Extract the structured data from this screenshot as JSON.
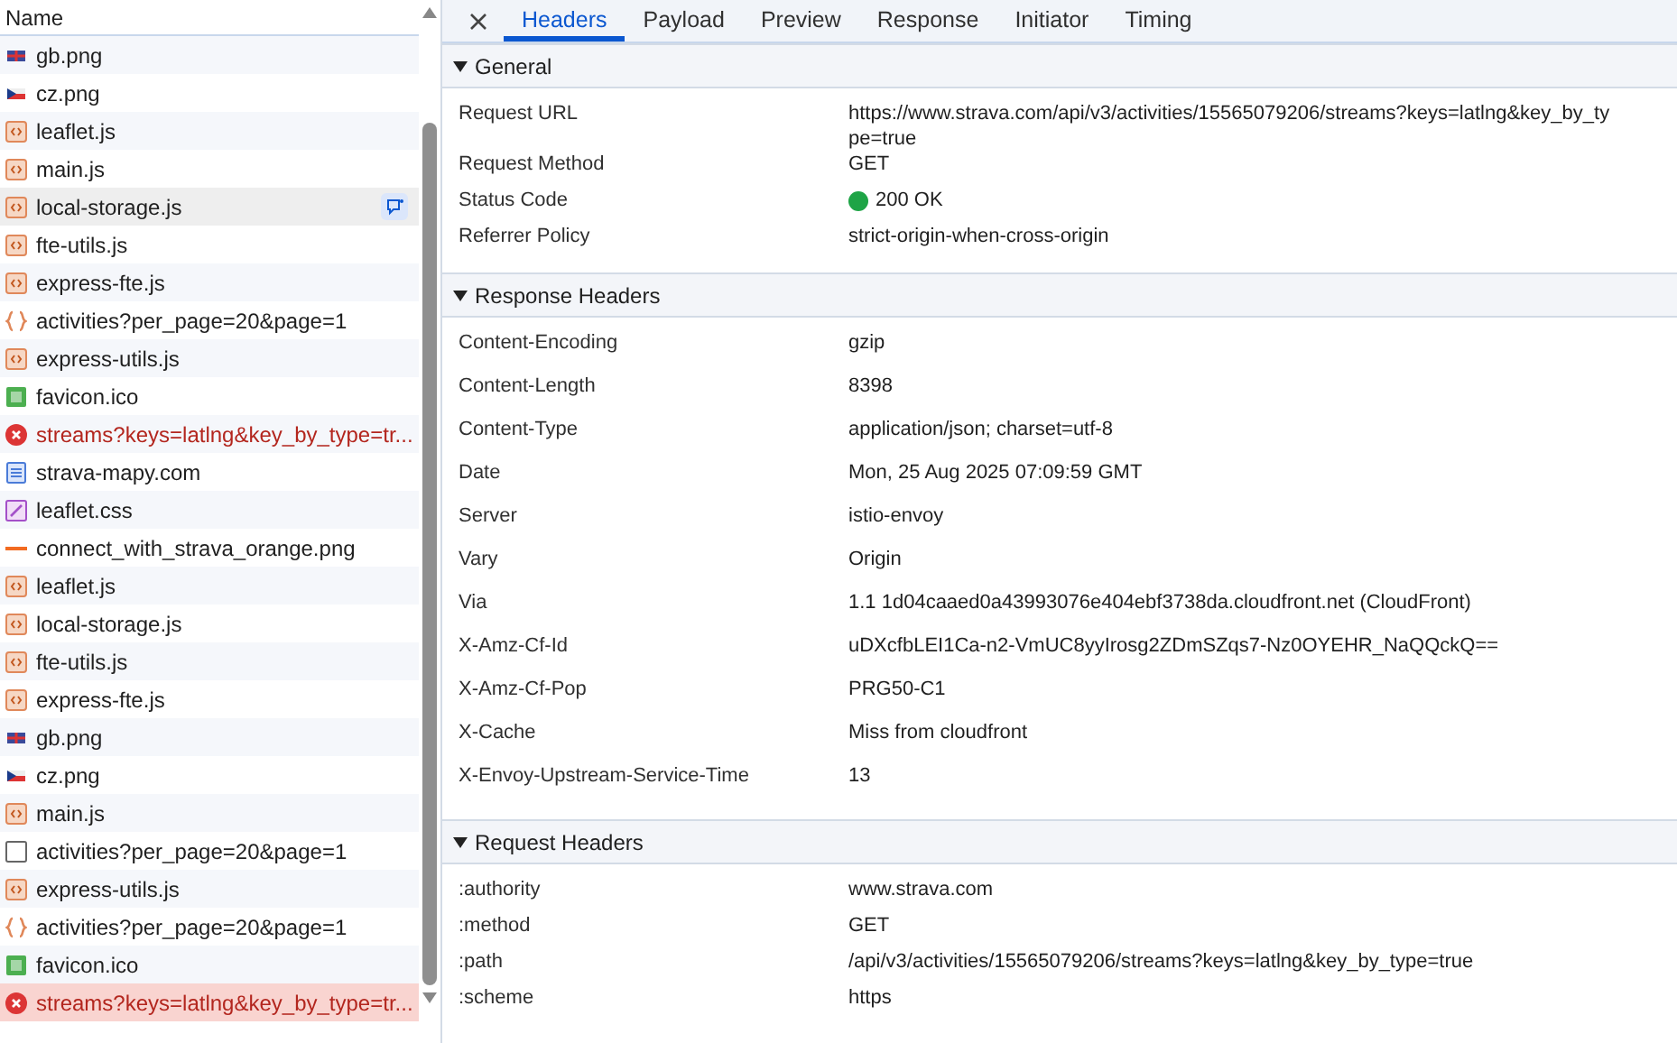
{
  "request_list": {
    "header": "Name",
    "rows": [
      {
        "name": "gb.png",
        "kind": "flag-gb",
        "error": false,
        "selected": false,
        "hovered": false
      },
      {
        "name": "cz.png",
        "kind": "flag-cz",
        "error": false,
        "selected": false,
        "hovered": false
      },
      {
        "name": "leaflet.js",
        "kind": "script",
        "error": false,
        "selected": false,
        "hovered": false
      },
      {
        "name": "main.js",
        "kind": "script",
        "error": false,
        "selected": false,
        "hovered": false
      },
      {
        "name": "local-storage.js",
        "kind": "script",
        "error": false,
        "selected": false,
        "hovered": true
      },
      {
        "name": "fte-utils.js",
        "kind": "script",
        "error": false,
        "selected": false,
        "hovered": false
      },
      {
        "name": "express-fte.js",
        "kind": "script",
        "error": false,
        "selected": false,
        "hovered": false
      },
      {
        "name": "activities?per_page=20&page=1",
        "kind": "fetch",
        "error": false,
        "selected": false,
        "hovered": false
      },
      {
        "name": "express-utils.js",
        "kind": "script",
        "error": false,
        "selected": false,
        "hovered": false
      },
      {
        "name": "favicon.ico",
        "kind": "image",
        "error": false,
        "selected": false,
        "hovered": false
      },
      {
        "name": "streams?keys=latlng&key_by_type=tr...",
        "kind": "error",
        "error": true,
        "selected": false,
        "hovered": false
      },
      {
        "name": "strava-mapy.com",
        "kind": "document",
        "error": false,
        "selected": false,
        "hovered": false
      },
      {
        "name": "leaflet.css",
        "kind": "stylesheet",
        "error": false,
        "selected": false,
        "hovered": false
      },
      {
        "name": "connect_with_strava_orange.png",
        "kind": "banner",
        "error": false,
        "selected": false,
        "hovered": false
      },
      {
        "name": "leaflet.js",
        "kind": "script",
        "error": false,
        "selected": false,
        "hovered": false
      },
      {
        "name": "local-storage.js",
        "kind": "script",
        "error": false,
        "selected": false,
        "hovered": false
      },
      {
        "name": "fte-utils.js",
        "kind": "script",
        "error": false,
        "selected": false,
        "hovered": false
      },
      {
        "name": "express-fte.js",
        "kind": "script",
        "error": false,
        "selected": false,
        "hovered": false
      },
      {
        "name": "gb.png",
        "kind": "flag-gb",
        "error": false,
        "selected": false,
        "hovered": false
      },
      {
        "name": "cz.png",
        "kind": "flag-cz",
        "error": false,
        "selected": false,
        "hovered": false
      },
      {
        "name": "main.js",
        "kind": "script",
        "error": false,
        "selected": false,
        "hovered": false
      },
      {
        "name": "activities?per_page=20&page=1",
        "kind": "other",
        "error": false,
        "selected": false,
        "hovered": false
      },
      {
        "name": "express-utils.js",
        "kind": "script",
        "error": false,
        "selected": false,
        "hovered": false
      },
      {
        "name": "activities?per_page=20&page=1",
        "kind": "fetch",
        "error": false,
        "selected": false,
        "hovered": false
      },
      {
        "name": "favicon.ico",
        "kind": "image",
        "error": false,
        "selected": false,
        "hovered": false
      },
      {
        "name": "streams?keys=latlng&key_by_type=tr...",
        "kind": "error",
        "error": true,
        "selected": true,
        "hovered": false
      }
    ]
  },
  "tabs": [
    {
      "label": "Headers",
      "selected": true
    },
    {
      "label": "Payload",
      "selected": false
    },
    {
      "label": "Preview",
      "selected": false
    },
    {
      "label": "Response",
      "selected": false
    },
    {
      "label": "Initiator",
      "selected": false
    },
    {
      "label": "Timing",
      "selected": false
    }
  ],
  "sections": [
    {
      "title": "General",
      "expanded": true,
      "rows": [
        {
          "name": "Request URL",
          "value": "https://www.strava.com/api/v3/activities/15565079206/streams?keys=latlng&key_by_ty",
          "value_cont": "pe=true"
        },
        {
          "name": "Request Method",
          "value": "GET"
        },
        {
          "name": "Status Code",
          "value": "200 OK",
          "color": "#1ea446"
        },
        {
          "name": "Referrer Policy",
          "value": "strict-origin-when-cross-origin"
        }
      ]
    },
    {
      "title": "Response Headers",
      "expanded": true,
      "rows": [
        {
          "name": "Content-Encoding",
          "value": "gzip"
        },
        {
          "name": "Content-Length",
          "value": "8398"
        },
        {
          "name": "Content-Type",
          "value": "application/json; charset=utf-8"
        },
        {
          "name": "Date",
          "value": "Mon, 25 Aug 2025 07:09:59 GMT"
        },
        {
          "name": "Server",
          "value": "istio-envoy"
        },
        {
          "name": "Vary",
          "value": "Origin"
        },
        {
          "name": "Via",
          "value": "1.1 1d04caaed0a43993076e404ebf3738da.cloudfront.net (CloudFront)"
        },
        {
          "name": "X-Amz-Cf-Id",
          "value": "uDXcfbLEI1Ca-n2-VmUC8yyIrosg2ZDmSZqs7-Nz0OYEHR_NaQQckQ=="
        },
        {
          "name": "X-Amz-Cf-Pop",
          "value": "PRG50-C1"
        },
        {
          "name": "X-Cache",
          "value": "Miss from cloudfront"
        },
        {
          "name": "X-Envoy-Upstream-Service-Time",
          "value": "13"
        }
      ]
    },
    {
      "title": "Request Headers",
      "expanded": true,
      "rows": [
        {
          "name": ":authority",
          "value": "www.strava.com"
        },
        {
          "name": ":method",
          "value": "GET"
        },
        {
          "name": ":path",
          "value": "/api/v3/activities/15565079206/streams?keys=latlng&key_by_type=true"
        },
        {
          "name": ":scheme",
          "value": "https"
        }
      ]
    }
  ]
}
